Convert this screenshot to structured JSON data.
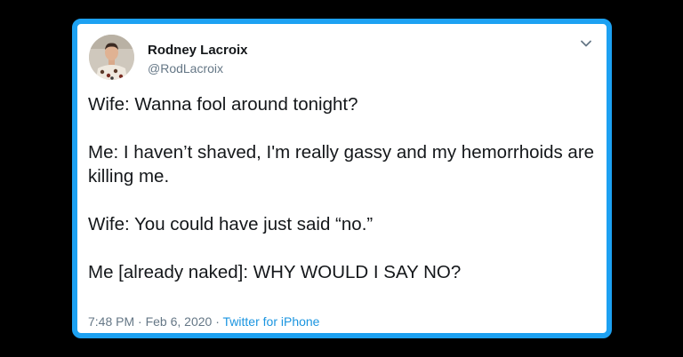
{
  "colors": {
    "frame_border": "#1DA1F2",
    "background": "#000000",
    "card": "#ffffff",
    "text_primary": "#14171A",
    "text_secondary": "#657786",
    "link": "#1B95E0"
  },
  "author": {
    "name": "Rodney Lacroix",
    "handle": "@RodLacroix",
    "avatar_icon": "profile-photo-avatar"
  },
  "menu_icon": "chevron-down-icon",
  "tweet": {
    "lines": [
      "Wife: Wanna fool around tonight?",
      "Me: I haven’t shaved, I'm really gassy and my hemorrhoids are killing me.",
      "Wife: You could have just said “no.”",
      "Me [already naked]: WHY WOULD I SAY NO?"
    ]
  },
  "meta": {
    "time": "7:48 PM",
    "separator": "·",
    "date": "Feb 6, 2020",
    "source": "Twitter for iPhone"
  }
}
